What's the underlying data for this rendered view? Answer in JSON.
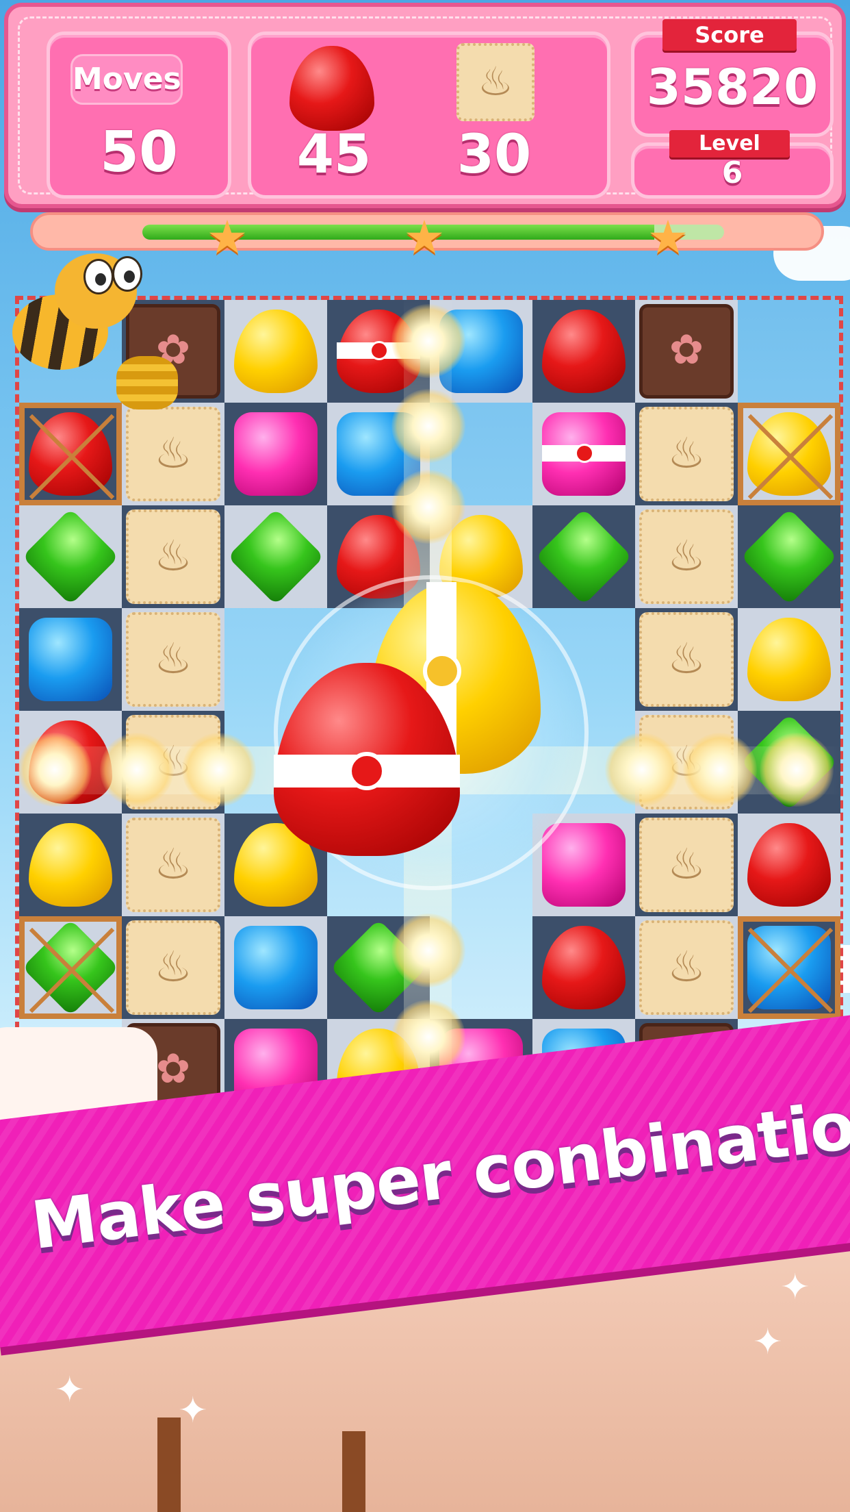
{
  "hud": {
    "moves_label": "Moves",
    "moves_value": "50",
    "goals": [
      {
        "icon": "red-gumdrop-icon",
        "count": "45"
      },
      {
        "icon": "cupcake-cookie-icon",
        "count": "30"
      }
    ],
    "score_label": "Score",
    "score_value": "35820",
    "level_label": "Level",
    "level_value": "6"
  },
  "progress": {
    "fraction": 0.88,
    "stars": 3
  },
  "board": {
    "rows": [
      [
        "empty",
        "chocolate",
        "yellow-drop",
        "red-drop-striped",
        "blue-square",
        "red-drop",
        "chocolate",
        "empty"
      ],
      [
        "red-drop-roped",
        "cookie",
        "pink-square",
        "blue-square",
        "empty",
        "pink-square-striped",
        "cookie",
        "yellow-drop-roped"
      ],
      [
        "green-diamond",
        "cookie",
        "green-diamond",
        "red-drop",
        "yellow-drop",
        "green-diamond",
        "cookie",
        "green-diamond"
      ],
      [
        "blue-square",
        "cookie",
        "empty",
        "empty",
        "empty",
        "empty",
        "cookie",
        "yellow-drop"
      ],
      [
        "red-drop",
        "cookie",
        "empty",
        "empty",
        "empty",
        "empty",
        "cookie",
        "green-diamond"
      ],
      [
        "yellow-drop",
        "cookie",
        "yellow-drop",
        "empty",
        "empty",
        "pink-square",
        "cookie",
        "red-drop"
      ],
      [
        "green-diamond-roped",
        "cookie",
        "blue-square",
        "green-diamond",
        "empty",
        "red-drop",
        "cookie",
        "blue-square-roped"
      ],
      [
        "empty",
        "chocolate",
        "pink-square",
        "yellow-drop",
        "pink-square",
        "blue-square",
        "chocolate",
        "empty"
      ]
    ]
  },
  "colors": {
    "hud_pink": "#ff6fb1",
    "banner_magenta": "#f020b8",
    "candy_red": "#e61818",
    "candy_yellow": "#ffd000",
    "candy_blue": "#1a9cf0",
    "candy_green": "#36c51c",
    "candy_pink": "#ff2fb2"
  },
  "banner": {
    "text": "Make super conbinations"
  }
}
